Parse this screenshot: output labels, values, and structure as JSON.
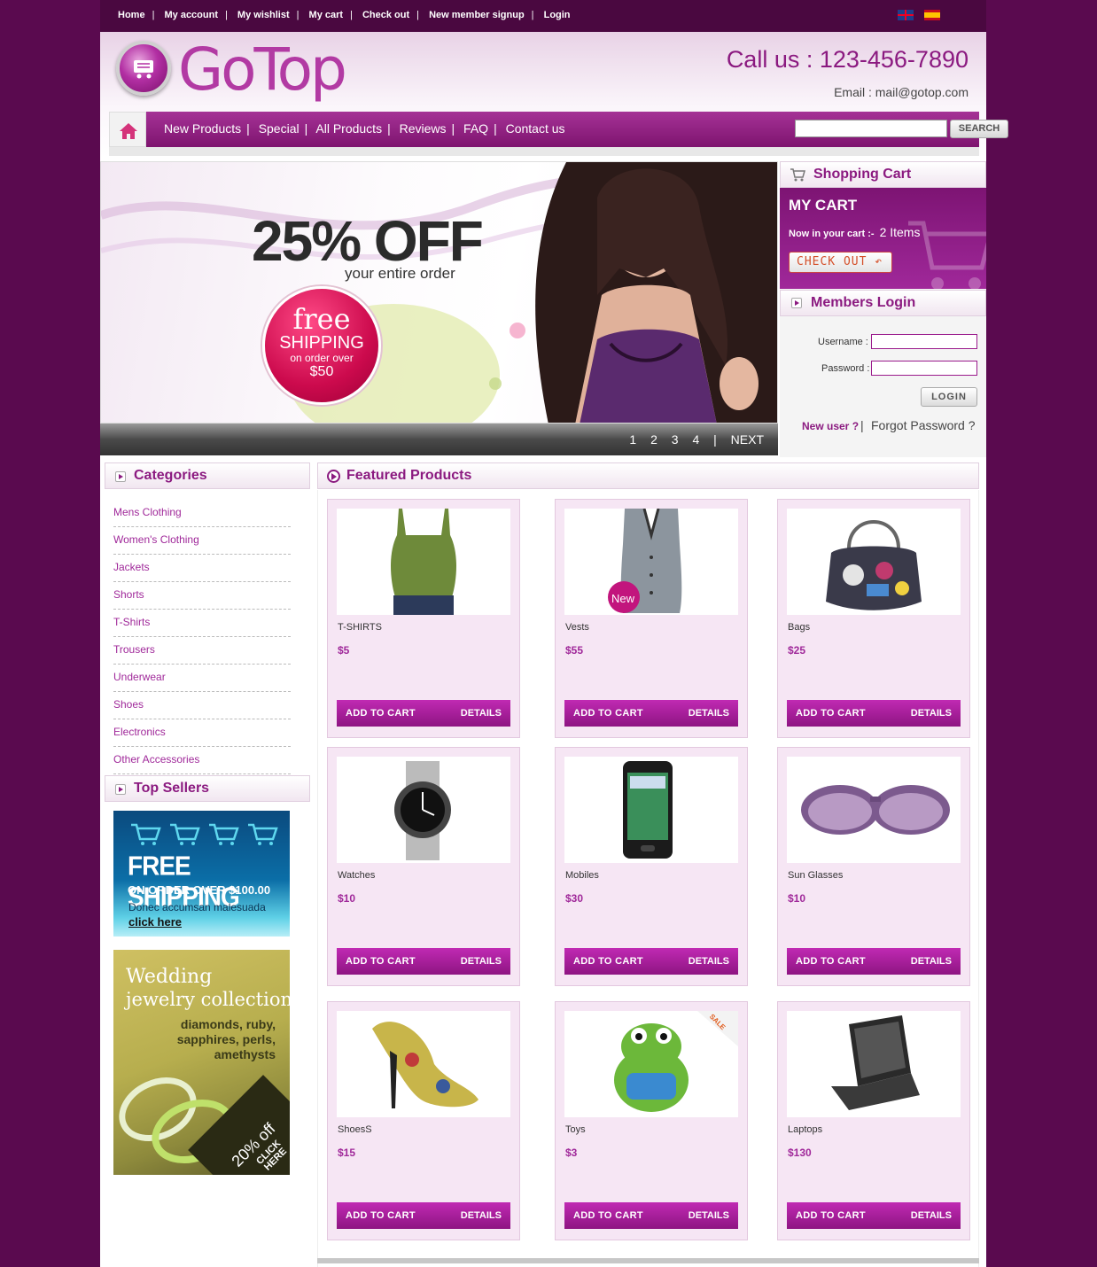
{
  "topbar": {
    "links": [
      "Home",
      "My account",
      "My wishlist",
      "My cart",
      "Check out",
      "New member signup",
      "Login"
    ]
  },
  "header": {
    "logo_text": "GoTop",
    "call_us": "Call us : 123-456-7890",
    "email": "Email :  mail@gotop.com"
  },
  "nav": {
    "items": [
      "New Products",
      "Special",
      "All Products",
      "Reviews",
      "FAQ",
      "Contact us"
    ],
    "search_placeholder": "",
    "search_label": "SEARCH"
  },
  "banner": {
    "headline": "25% OFF",
    "subline": "your entire order",
    "circle_free": "free",
    "circle_shipping": "SHIPPING",
    "circle_order": "on order over",
    "circle_amount": "$50",
    "pages": [
      "1",
      "2",
      "3",
      "4"
    ],
    "next": "NEXT"
  },
  "cart": {
    "heading": "Shopping Cart",
    "title": "MY CART",
    "now_label": "Now in your cart :-",
    "count": "2 Items",
    "checkout": "CHECK OUT"
  },
  "login": {
    "heading": "Members Login",
    "username_label": "Username :",
    "password_label": "Password :",
    "button": "LOGIN",
    "new_user": "New user ?",
    "forgot": "Forgot Password ?"
  },
  "categories": {
    "heading": "Categories",
    "items": [
      "Mens Clothing",
      "Women's Clothing",
      "Jackets",
      "Shorts",
      "T-Shirts",
      "Trousers",
      "Underwear",
      "Shoes",
      "Electronics",
      "Other Accessories"
    ]
  },
  "top_sellers": {
    "heading": "Top Sellers",
    "free_shipping": {
      "title": "FREE SHIPPING",
      "sub": "ON ORDER OVER $100.00",
      "desc": "Donec accumsan malesuada",
      "link": "click here"
    },
    "wedding": {
      "line1": "Wedding",
      "line2": "jewelry collection",
      "line3": "diamonds, ruby, sapphires, perls, amethysts",
      "off": "20% off",
      "click": "CLICK HERE"
    }
  },
  "featured": {
    "heading": "Featured Products",
    "add_label": "ADD TO CART",
    "details_label": "DETAILS",
    "new_badge": "New",
    "sale_badge": "SALE",
    "products": [
      {
        "name": "T-SHIRTS",
        "price": "$5"
      },
      {
        "name": "Vests",
        "price": "$55"
      },
      {
        "name": "Bags",
        "price": "$25"
      },
      {
        "name": "Watches",
        "price": "$10"
      },
      {
        "name": "Mobiles",
        "price": "$30"
      },
      {
        "name": "Sun Glasses",
        "price": "$10"
      },
      {
        "name": "ShoesS",
        "price": "$15"
      },
      {
        "name": "Toys",
        "price": "$3"
      },
      {
        "name": "Laptops",
        "price": "$130"
      }
    ]
  },
  "colors": {
    "page_bg": "#5a0a4f",
    "accent": "#8b1a80",
    "button_purple": "#a0299a"
  }
}
